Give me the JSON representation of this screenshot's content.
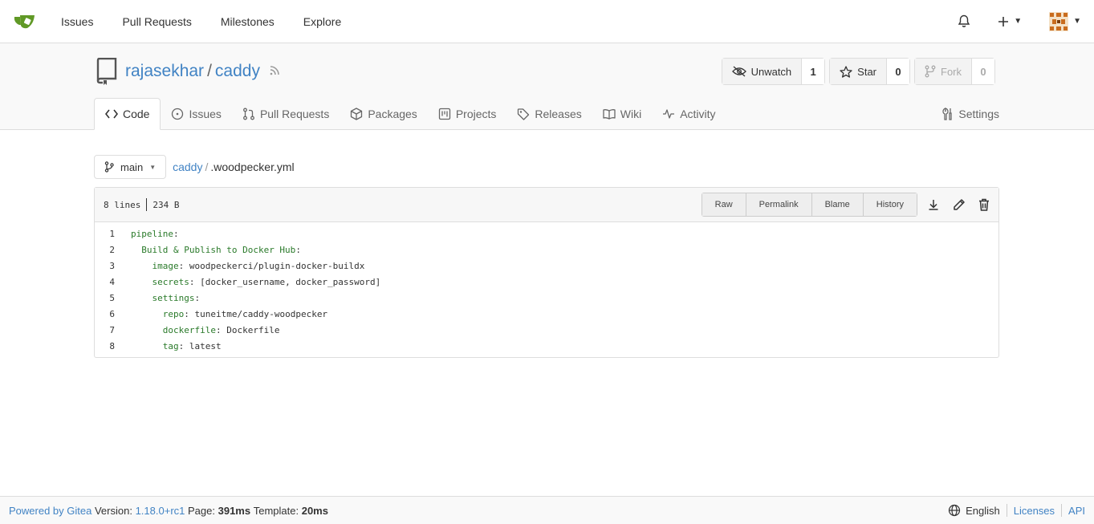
{
  "nav": {
    "items": [
      "Issues",
      "Pull Requests",
      "Milestones",
      "Explore"
    ],
    "plus_icon": "plus-icon",
    "bell_icon": "bell-icon"
  },
  "repo": {
    "owner": "rajasekhar",
    "name": "caddy",
    "watch": {
      "label": "Unwatch",
      "count": "1"
    },
    "star": {
      "label": "Star",
      "count": "0"
    },
    "fork": {
      "label": "Fork",
      "count": "0"
    }
  },
  "tabs": {
    "code": "Code",
    "issues": "Issues",
    "pulls": "Pull Requests",
    "packages": "Packages",
    "projects": "Projects",
    "releases": "Releases",
    "wiki": "Wiki",
    "activity": "Activity",
    "settings": "Settings"
  },
  "breadcrumb": {
    "branch": "main",
    "repo": "caddy",
    "sep": "/",
    "file": ".woodpecker.yml"
  },
  "file": {
    "lines_label": "8 lines",
    "size": "234 B",
    "buttons": {
      "raw": "Raw",
      "permalink": "Permalink",
      "blame": "Blame",
      "history": "History"
    },
    "code": [
      {
        "n": "1",
        "key": "pipeline",
        "rest": ":",
        "indent": ""
      },
      {
        "n": "2",
        "key": "Build & Publish to Docker Hub",
        "rest": ":",
        "indent": "  "
      },
      {
        "n": "3",
        "key": "image",
        "rest": ": woodpeckerci/plugin-docker-buildx",
        "indent": "    "
      },
      {
        "n": "4",
        "key": "secrets",
        "rest": ": [docker_username, docker_password]",
        "indent": "    "
      },
      {
        "n": "5",
        "key": "settings",
        "rest": ":",
        "indent": "    "
      },
      {
        "n": "6",
        "key": "repo",
        "rest": ": tuneitme/caddy-woodpecker",
        "indent": "      "
      },
      {
        "n": "7",
        "key": "dockerfile",
        "rest": ": Dockerfile",
        "indent": "      "
      },
      {
        "n": "8",
        "key": "tag",
        "rest": ": latest",
        "indent": "      "
      }
    ]
  },
  "footer": {
    "powered": "Powered by Gitea",
    "version_label": "Version:",
    "version": "1.18.0+rc1",
    "page_label": "Page:",
    "page_time": "391ms",
    "template_label": "Template:",
    "template_time": "20ms",
    "language": "English",
    "licenses": "Licenses",
    "api": "API"
  },
  "colors": {
    "link": "#4183c4",
    "key": "#2a7a2a",
    "logo": "#609926"
  }
}
